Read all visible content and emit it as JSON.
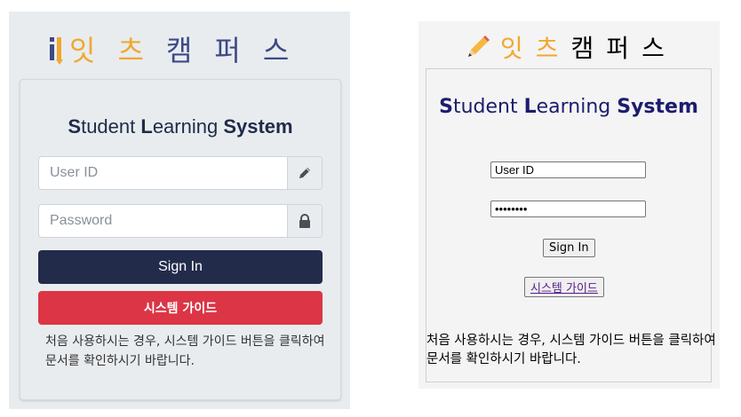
{
  "left": {
    "logo_chars": [
      "잇",
      "츠",
      "캠",
      "퍼",
      "스"
    ],
    "logo_colors": [
      "#f0a830",
      "#f0a830",
      "#3d4a86",
      "#3d4a86",
      "#3d4a86"
    ],
    "title_parts": [
      {
        "text": "S",
        "bold": true
      },
      {
        "text": "tudent ",
        "bold": false
      },
      {
        "text": "L",
        "bold": true
      },
      {
        "text": "earning ",
        "bold": false
      },
      {
        "text": "System",
        "bold": true
      }
    ],
    "userid_placeholder": "User ID",
    "userid_icon": "pencil-icon",
    "password_placeholder": "Password",
    "password_icon": "lock-icon",
    "signin_label": "Sign In",
    "guide_label": "시스템 가이드",
    "note": "처음 사용하시는 경우, 시스템 가이드 버튼을 클릭하여 문서를 확인하시기 바랍니다.",
    "colors": {
      "signin": "#222b4a",
      "guide": "#dc3545"
    }
  },
  "right": {
    "logo_icon": "pencil-emoji-icon",
    "logo_chars": [
      "잇",
      "츠",
      "캠",
      "퍼",
      "스"
    ],
    "logo_colors": [
      "#f0a830",
      "#f0a830",
      "#000000",
      "#000000",
      "#000000"
    ],
    "title_parts": [
      {
        "text": "S",
        "bold": true
      },
      {
        "text": "tudent ",
        "bold": false
      },
      {
        "text": "L",
        "bold": true
      },
      {
        "text": "earning ",
        "bold": false
      },
      {
        "text": "System",
        "bold": true
      }
    ],
    "userid_value": "User ID",
    "password_value": "••••••••",
    "signin_label": "Sign In",
    "guide_label": "시스템 가이드",
    "note": "처음 사용하시는 경우, 시스템 가이드 버튼을 클릭하여 문서를 확인하시기 바랍니다."
  }
}
